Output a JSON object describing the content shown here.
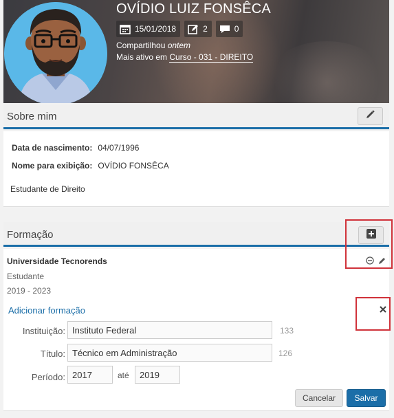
{
  "profile": {
    "name": "OVÍDIO LUIZ FONSÊCA",
    "date": "15/01/2018",
    "edits_count": "2",
    "comments_count": "0",
    "shared_prefix": "Compartilhou ",
    "shared_when": "ontem",
    "active_prefix": "Mais ativo em ",
    "active_course": "Curso - 031 - DIREITO"
  },
  "about": {
    "title": "Sobre mim",
    "birth_label": "Data de nascimento:",
    "birth_value": "04/07/1996",
    "display_label": "Nome para exibição:",
    "display_value": "OVÍDIO FONSÊCA",
    "bio": "Estudante de Direito"
  },
  "education": {
    "title": "Formação",
    "entry": {
      "school": "Universidade Tecnorends",
      "role": "Estudante",
      "period": "2019 - 2023"
    },
    "add_link": "Adicionar formação",
    "form": {
      "institution_label": "Instituição:",
      "institution_value": "Instituto Federal",
      "institution_count": "133",
      "title_label": "Título:",
      "title_value": "Técnico em Administração",
      "title_count": "126",
      "period_label": "Período:",
      "period_from": "2017",
      "period_sep": "até",
      "period_to": "2019",
      "cancel_label": "Cancelar",
      "save_label": "Salvar"
    }
  },
  "colors": {
    "accent": "#1b6ea8",
    "highlight_box": "#d0323a"
  },
  "icons": {
    "calendar": "calendar-icon",
    "edit": "pencil-square-icon",
    "comment": "comment-icon",
    "pencil": "pencil-icon",
    "plus": "plus-square-icon",
    "minus": "minus-circle-icon",
    "close": "close-icon"
  }
}
